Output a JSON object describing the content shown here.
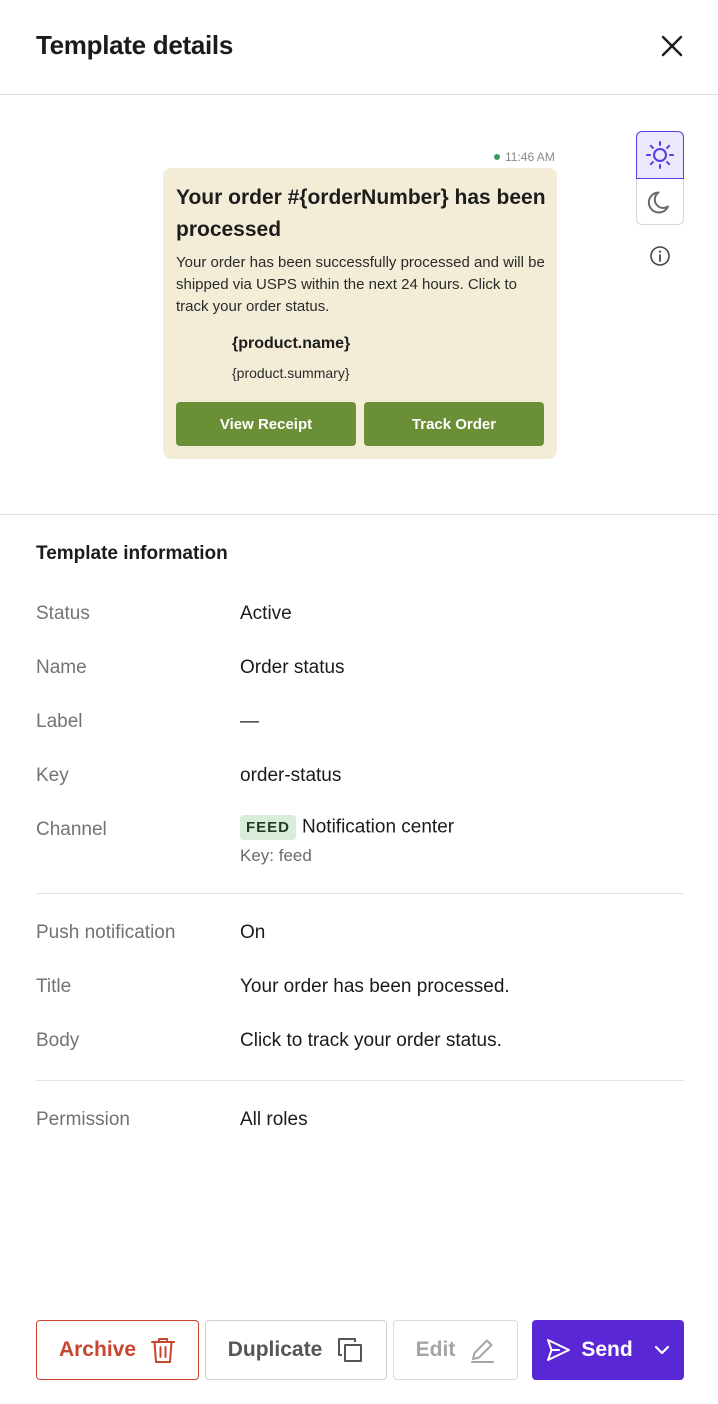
{
  "header": {
    "title": "Template details"
  },
  "preview": {
    "timestamp": "11:46 AM",
    "card": {
      "title": "Your order #{orderNumber} has been processed",
      "body": "Your order has been successfully processed and will be shipped via USPS within the next 24 hours. Click to track your order status.",
      "product_name": "{product.name}",
      "product_summary": "{product.summary}",
      "primary_button": "View Receipt",
      "secondary_button": "Track Order"
    },
    "theme": {
      "selected": "light"
    }
  },
  "info": {
    "section_title": "Template information",
    "status": {
      "label": "Status",
      "value": "Active"
    },
    "name": {
      "label": "Name",
      "value": "Order status"
    },
    "label_row": {
      "label": "Label",
      "value": "—"
    },
    "key": {
      "label": "Key",
      "value": "order-status"
    },
    "channel": {
      "label": "Channel",
      "badge": "FEED",
      "value": "Notification center",
      "key_line": "Key: feed"
    },
    "push": {
      "label": "Push notification",
      "value": "On"
    },
    "title_row": {
      "label": "Title",
      "value": "Your order has been processed."
    },
    "body_row": {
      "label": "Body",
      "value": "Click to track your order status."
    },
    "permission": {
      "label": "Permission",
      "value": "All roles"
    }
  },
  "footer": {
    "archive": "Archive",
    "duplicate": "Duplicate",
    "edit": "Edit",
    "send": "Send"
  },
  "colors": {
    "accent": "#5a27d6",
    "card_bg": "#f3ecd7",
    "card_button": "#6a8f36",
    "danger": "#c8452f",
    "badge_bg": "#d8ecd9"
  }
}
